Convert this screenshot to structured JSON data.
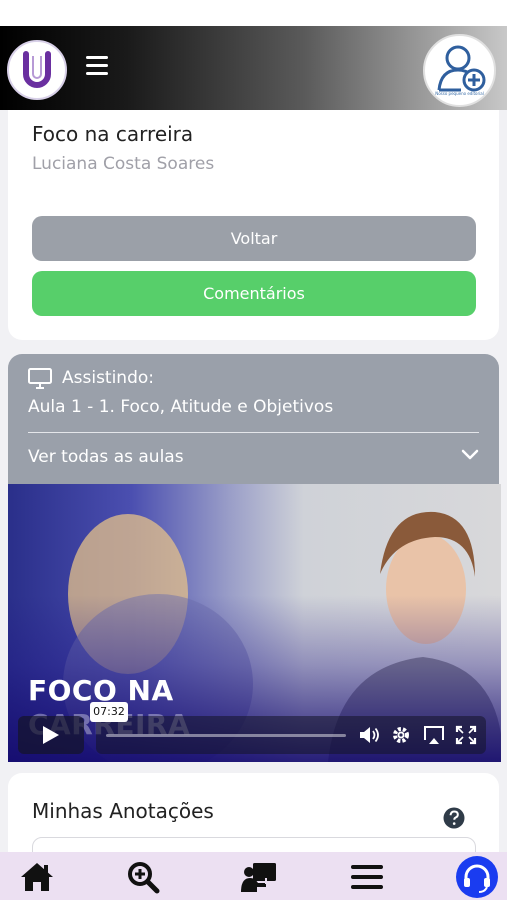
{
  "header": {
    "logo_letter": "U",
    "avatar_caption": "Nosso pequeno editorial"
  },
  "course": {
    "title": "Foco na carreira",
    "author": "Luciana Costa Soares",
    "back_label": "Voltar",
    "comments_label": "Comentários"
  },
  "lesson_panel": {
    "watching_label": "Assistindo:",
    "current_lesson": "Aula 1 - 1. Foco, Atitude e Objetivos",
    "all_lessons_label": "Ver todas as aulas"
  },
  "video": {
    "title_line1": "FOCO NA",
    "title_line2": "CARREIRA",
    "hover_time": "07:32"
  },
  "notes": {
    "title": "Minhas Anotações"
  },
  "bottom_nav": {
    "items": [
      "home-icon",
      "zoom-in-icon",
      "presentation-icon",
      "menu-icon",
      "headset-icon"
    ]
  },
  "colors": {
    "back_button": "#9ba0a8",
    "comments_button": "#57cf6a",
    "lesson_panel": "#9aa0aa",
    "logo_purple": "#6a2fa0",
    "support_blue": "#1a3cf0",
    "nav_background": "#ece0f2"
  }
}
